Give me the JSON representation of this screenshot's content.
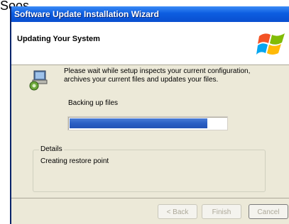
{
  "stray_text": "Soos",
  "window": {
    "title": "Software Update Installation Wizard"
  },
  "header": {
    "title": "Updating Your System"
  },
  "main": {
    "description": "Please wait while setup inspects your current configuration, archives your current files and updates your files.",
    "status": "Backing up files",
    "progress": 0.88
  },
  "details": {
    "legend": "Details",
    "text": "Creating restore point"
  },
  "buttons": {
    "back": "< Back",
    "finish": "Finish",
    "cancel": "Cancel"
  },
  "colors": {
    "titlebar": "#0c5de0",
    "progress": "#2b5fc4",
    "window_bg": "#ece9d8"
  }
}
